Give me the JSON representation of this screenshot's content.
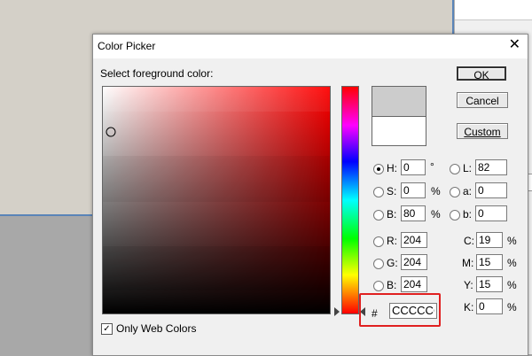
{
  "dialog": {
    "title": "Color Picker",
    "close_glyph": "✕",
    "prompt": "Select foreground color:",
    "ok_label": "OK",
    "cancel_label": "Cancel",
    "custom_label": "Custom",
    "only_web_colors_label": "Only Web Colors",
    "only_web_colors_checked": true,
    "current_color": "#cccccc",
    "previous_color": "#ffffff"
  },
  "hsb": {
    "h_label": "H:",
    "h_value": "0",
    "h_unit": "°",
    "s_label": "S:",
    "s_value": "0",
    "s_unit": "%",
    "b_label": "B:",
    "b_value": "80",
    "b_unit": "%",
    "selected": "H"
  },
  "lab": {
    "l_label": "L:",
    "l_value": "82",
    "a_label": "a:",
    "a_value": "0",
    "b_label": "b:",
    "b_value": "0"
  },
  "rgb": {
    "r_label": "R:",
    "r_value": "204",
    "g_label": "G:",
    "g_value": "204",
    "b_label": "B:",
    "b_value": "204"
  },
  "cmyk": {
    "c_label": "C:",
    "c_value": "19",
    "m_label": "M:",
    "m_value": "15",
    "y_label": "Y:",
    "y_value": "15",
    "k_label": "K:",
    "k_value": "0",
    "unit": "%"
  },
  "hex": {
    "label": "#",
    "value": "CCCCCC"
  },
  "icons": {
    "close": "close-icon",
    "slider_left": "slider-arrow-left-icon",
    "slider_right": "slider-arrow-right-icon"
  }
}
